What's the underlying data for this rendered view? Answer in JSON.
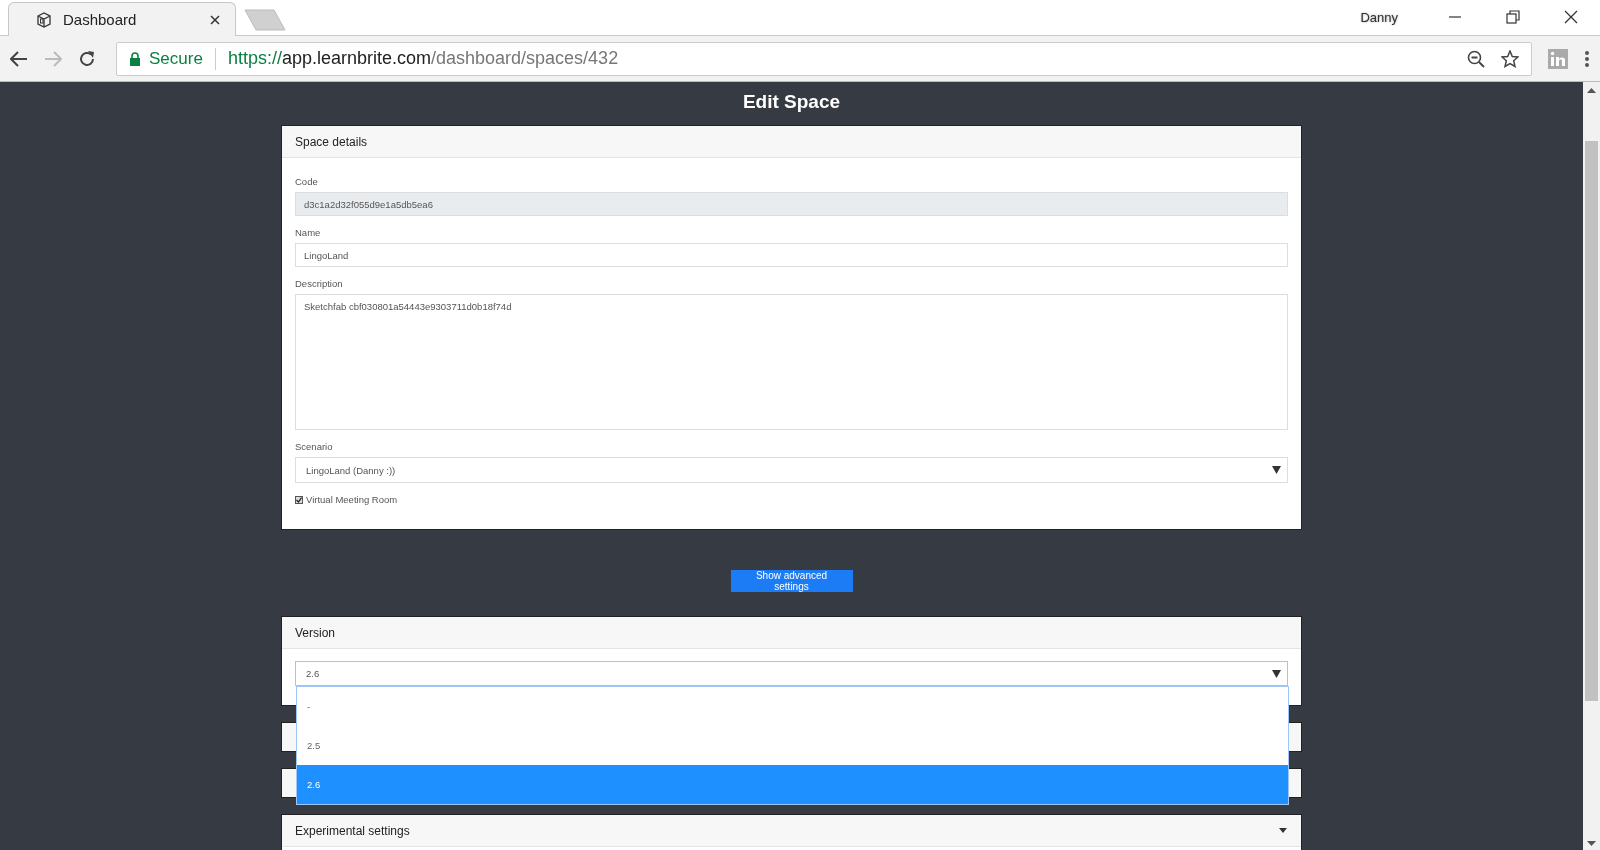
{
  "browser": {
    "tabs": [
      {
        "title": "Dashboard",
        "selected": true
      }
    ],
    "url": {
      "secure_label": "Secure",
      "scheme": "https://",
      "host": "app.learnbrite.com",
      "path": "/dashboard/spaces/432"
    },
    "profile_name": "Danny"
  },
  "page": {
    "title": "Edit Space"
  },
  "space_details": {
    "title": "Space details",
    "fields": [
      {
        "kind": "readonly",
        "label": "Code",
        "value": "d3c1a2d32f055d9e1a5db5ea6"
      },
      {
        "kind": "text",
        "label": "Name",
        "value": "LingoLand"
      },
      {
        "kind": "textarea",
        "label": "Description",
        "value": "Sketchfab cbf030801a54443e9303711d0b18f74d"
      },
      {
        "kind": "select",
        "label": "Scenario",
        "value": "LingoLand (Danny :))"
      },
      {
        "kind": "checkbox",
        "label": "Virtual Meeting Room",
        "checked": true
      }
    ]
  },
  "advanced_button": "Show advanced settings",
  "version": {
    "title": "Version",
    "value": "2.6",
    "expanded": true,
    "options": [
      {
        "label": "-",
        "selected": false
      },
      {
        "label": "2.5",
        "selected": false
      },
      {
        "label": "2.6",
        "selected": true
      }
    ]
  },
  "experimental": {
    "title": "Experimental settings"
  }
}
